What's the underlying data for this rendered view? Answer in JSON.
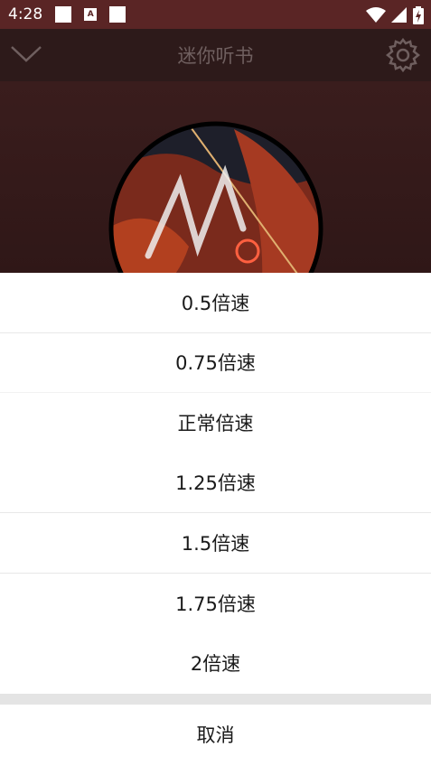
{
  "status_bar": {
    "time": "4:28",
    "icons": [
      "notification-square-icon",
      "a-notification-icon",
      "notification-square-icon",
      "wifi-icon",
      "signal-icon",
      "battery-charging-icon"
    ]
  },
  "header": {
    "title": "迷你听书",
    "left_icon": "chevron-down-icon",
    "right_icon": "gear-icon"
  },
  "speed_sheet": {
    "options": [
      {
        "label": "0.5倍速"
      },
      {
        "label": "0.75倍速"
      },
      {
        "label": "正常倍速"
      },
      {
        "label": "1.25倍速"
      },
      {
        "label": "1.5倍速"
      },
      {
        "label": "1.75倍速"
      },
      {
        "label": "2倍速"
      }
    ],
    "cancel_label": "取消"
  }
}
